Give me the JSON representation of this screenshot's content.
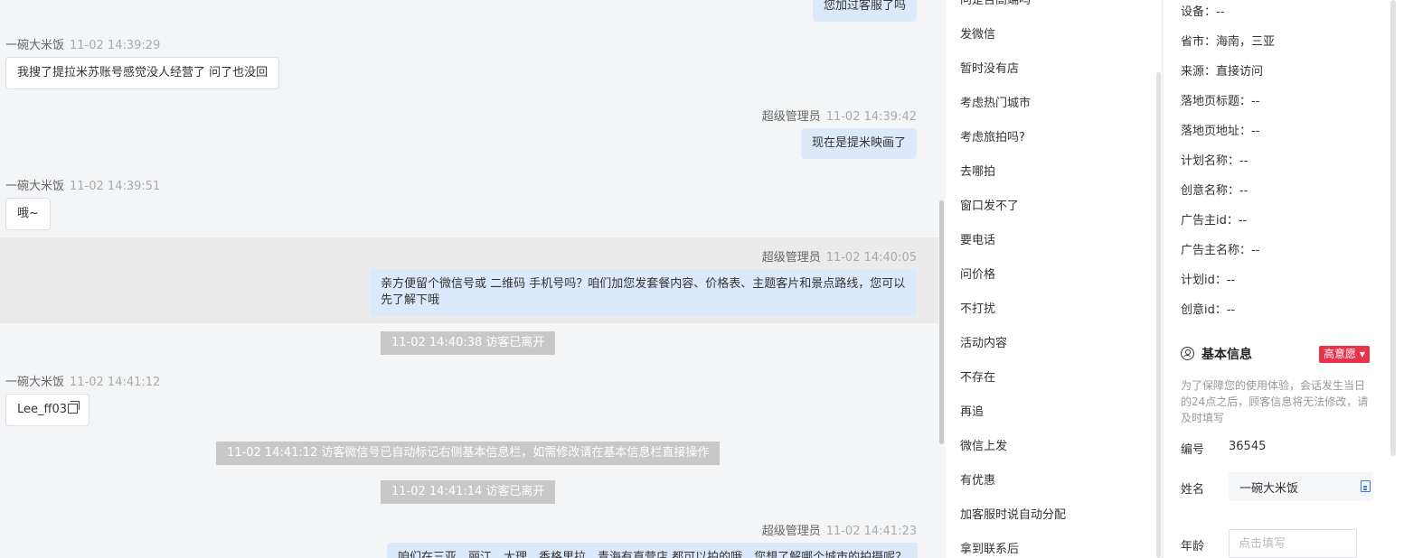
{
  "chat": {
    "top_bubble": "您加过客服了吗",
    "messages": [
      {
        "name": "一碗大米饭",
        "time": "11-02 14:39:29",
        "text": "我搜了提拉米苏账号感觉没人经营了 问了也没回"
      },
      {
        "name": "超级管理员",
        "time": "11-02 14:39:42",
        "text": "现在是提米映画了"
      },
      {
        "name": "一碗大米饭",
        "time": "11-02 14:39:51",
        "text": "哦~"
      },
      {
        "name": "超级管理员",
        "time": "11-02 14:40:05",
        "text_line1": "亲方便留个微信号或 二维码 手机号吗？咱们加您发套餐内容、价格表、主题客片和景点路线，您可以",
        "text_line2": "先了解下哦"
      },
      {
        "name": "一碗大米饭",
        "time": "11-02 14:41:12",
        "text": "Lee_ff03"
      },
      {
        "name": "超级管理员",
        "time": "11-02 14:41:23",
        "text": "咱们在三亚、丽江、大理、香格里拉、青海有直营店 都可以拍的哦，您想了解哪个城市的拍摄呢？"
      }
    ],
    "system": [
      "11-02 14:40:38 访客已离开",
      "11-02 14:41:12 访客微信号已自动标记右侧基本信息栏，如需修改请在基本信息栏直接操作",
      "11-02 14:41:14 访客已离开"
    ]
  },
  "quick_replies": [
    "问是否高端吗",
    "发微信",
    "暂时没有店",
    "考虑热门城市",
    "考虑旅拍吗?",
    "去哪拍",
    "窗口发不了",
    "要电话",
    "问价格",
    "不打扰",
    "活动内容",
    "不存在",
    "再追",
    "微信上发",
    "有优惠",
    "加客服时说自动分配",
    "拿到联系后"
  ],
  "info": {
    "rows": [
      "设备：--",
      "省市：海南，三亚",
      "来源：直接访问",
      "落地页标题：--",
      "落地页地址：--",
      "计划名称：--",
      "创意名称：--",
      "广告主id：--",
      "广告主名称：--",
      "计划id：--",
      "创意id：--"
    ],
    "section_title": "基本信息",
    "intent_badge": "高意愿 ▾",
    "note": "为了保障您的使用体验，会话发生当日的24点之后，顾客信息将无法修改，请及时填写",
    "id_label": "编号",
    "id_value": "36545",
    "name_label": "姓名",
    "name_value": "一碗大米饭",
    "age_label": "年龄",
    "age_placeholder": "点击填写"
  }
}
